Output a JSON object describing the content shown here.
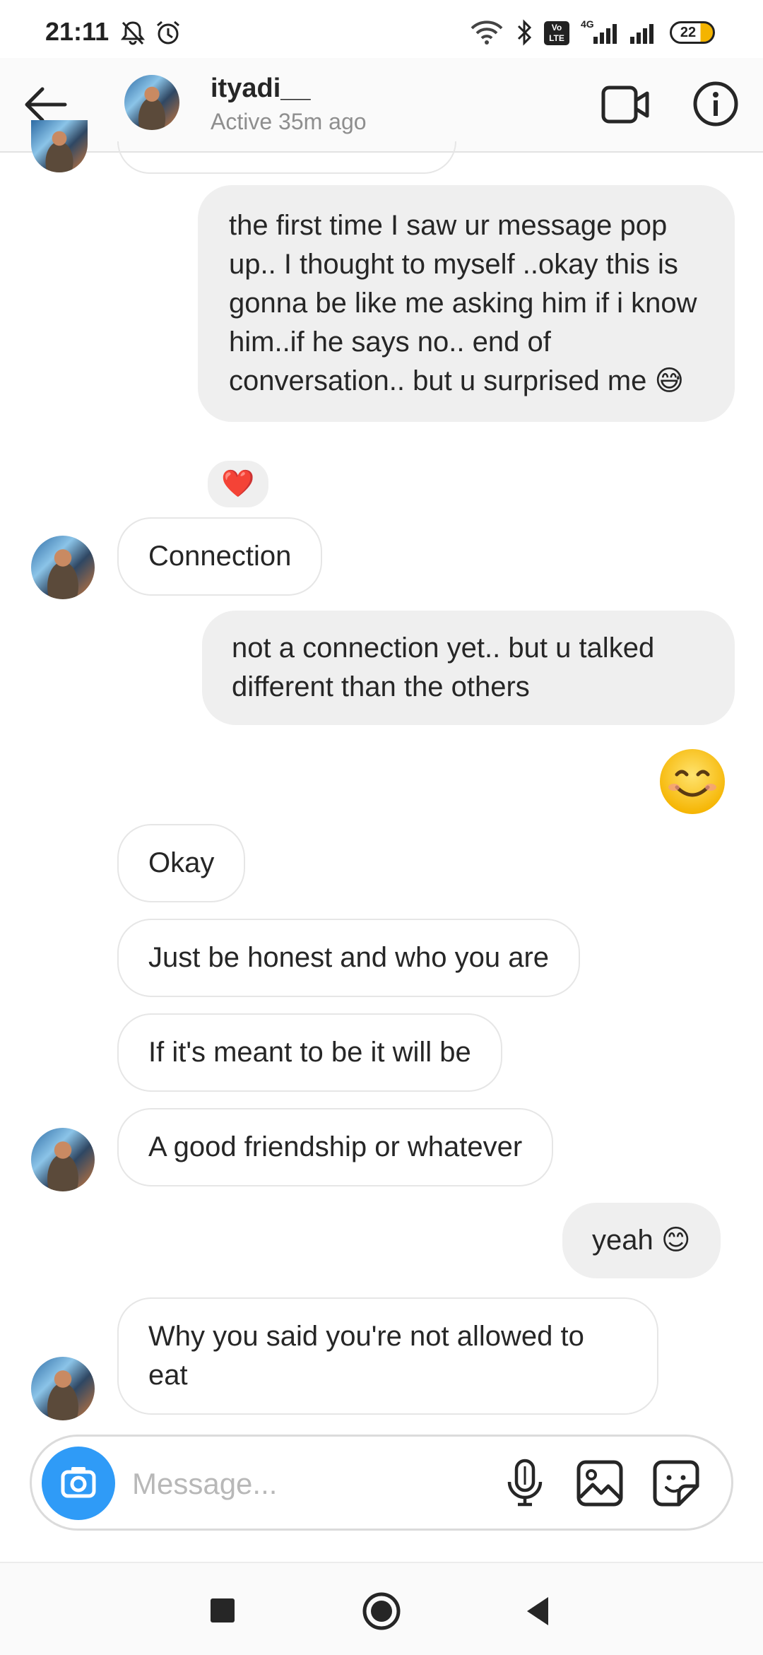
{
  "status_bar": {
    "time": "21:11",
    "network_label": "4G",
    "volte_label": "Vo LTE",
    "battery_percent": "22"
  },
  "header": {
    "contact_name": "ityadi__",
    "contact_status": "Active 35m ago"
  },
  "messages": [
    {
      "direction": "outgoing",
      "text": "the first time I saw ur message pop up.. I thought to myself ..okay this is gonna be  like me asking him if i know him..if he says no.. end of conversation.. but u surprised me 😅",
      "reaction": "❤️"
    },
    {
      "direction": "incoming",
      "text": "Connection"
    },
    {
      "direction": "outgoing",
      "text": "not a connection yet.. but u talked different than the others"
    },
    {
      "direction": "outgoing",
      "text": "😊"
    },
    {
      "direction": "incoming",
      "text": "Okay"
    },
    {
      "direction": "incoming",
      "text": "Just be honest and who you are"
    },
    {
      "direction": "incoming",
      "text": "If it's meant to be it will be"
    },
    {
      "direction": "incoming",
      "text": "A good friendship or whatever"
    },
    {
      "direction": "outgoing",
      "text": "yeah 😊"
    },
    {
      "direction": "incoming",
      "text": "Why you said you're not allowed to eat"
    }
  ],
  "composer": {
    "placeholder": "Message..."
  },
  "colors": {
    "accent_blue": "#2f9bf7",
    "outgoing_bubble": "#efefef",
    "incoming_border": "#e6e6e6",
    "reaction_heart": "#e0112b"
  }
}
